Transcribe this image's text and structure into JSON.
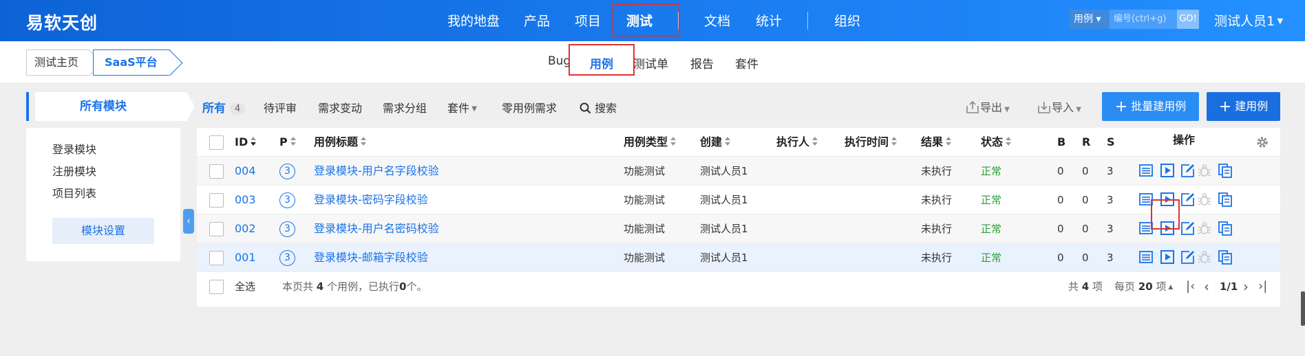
{
  "brand": "易软天创",
  "nav": {
    "items": [
      {
        "label": "我的地盘",
        "active": false
      },
      {
        "label": "产品",
        "active": false
      },
      {
        "label": "项目",
        "active": false
      },
      {
        "label": "测试",
        "active": true
      },
      {
        "label": "文档",
        "active": false
      },
      {
        "label": "统计",
        "active": false
      },
      {
        "label": "组织",
        "active": false
      }
    ]
  },
  "search": {
    "type": "用例",
    "placeholder": "编号(ctrl+g)",
    "go": "GO!"
  },
  "user": "测试人员1",
  "breadcrumb": {
    "home": "测试主页",
    "product": "SaaS平台"
  },
  "subnav": [
    "Bug",
    "用例",
    "测试单",
    "报告",
    "套件"
  ],
  "modules": {
    "title": "所有模块",
    "items": [
      "登录模块",
      "注册模块",
      "项目列表"
    ],
    "settings": "模块设置"
  },
  "filters": {
    "all": "所有",
    "all_count": "4",
    "tabs": [
      "待评审",
      "需求变动",
      "需求分组",
      "套件",
      "零用例需求"
    ],
    "search": "搜索",
    "export": "导出",
    "import": "导入",
    "batch_create": "批量建用例",
    "create": "建用例"
  },
  "table": {
    "headers": {
      "id": "ID",
      "pri": "P",
      "title": "用例标题",
      "type": "用例类型",
      "creator": "创建",
      "executor": "执行人",
      "exec_time": "执行时间",
      "result": "结果",
      "status": "状态",
      "b": "B",
      "r": "R",
      "s": "S",
      "actions": "操作"
    },
    "rows": [
      {
        "id": "004",
        "pri": "3",
        "title": "登录模块-用户名字段校验",
        "type": "功能测试",
        "creator": "测试人员1",
        "executor": "",
        "exec_time": "",
        "result": "未执行",
        "status": "正常",
        "b": "0",
        "r": "0",
        "s": "3"
      },
      {
        "id": "003",
        "pri": "3",
        "title": "登录模块-密码字段校验",
        "type": "功能测试",
        "creator": "测试人员1",
        "executor": "",
        "exec_time": "",
        "result": "未执行",
        "status": "正常",
        "b": "0",
        "r": "0",
        "s": "3"
      },
      {
        "id": "002",
        "pri": "3",
        "title": "登录模块-用户名密码校验",
        "type": "功能测试",
        "creator": "测试人员1",
        "executor": "",
        "exec_time": "",
        "result": "未执行",
        "status": "正常",
        "b": "0",
        "r": "0",
        "s": "3"
      },
      {
        "id": "001",
        "pri": "3",
        "title": "登录模块-邮箱字段校验",
        "type": "功能测试",
        "creator": "测试人员1",
        "executor": "",
        "exec_time": "",
        "result": "未执行",
        "status": "正常",
        "b": "0",
        "r": "0",
        "s": "3"
      }
    ],
    "footer": {
      "select_all": "全选",
      "summary_pre": "本页共",
      "summary_count": "4",
      "summary_mid": "个用例，已执行",
      "summary_exec": "0",
      "summary_post": "个。",
      "total_pre": "共",
      "total": "4",
      "total_post": "项",
      "per_page_pre": "每页",
      "per_page": "20",
      "per_page_post": "项",
      "page": "1/1"
    }
  },
  "colors": {
    "primary": "#1a73e8",
    "ok": "#2e9e3a",
    "highlight": "#e0312f"
  }
}
